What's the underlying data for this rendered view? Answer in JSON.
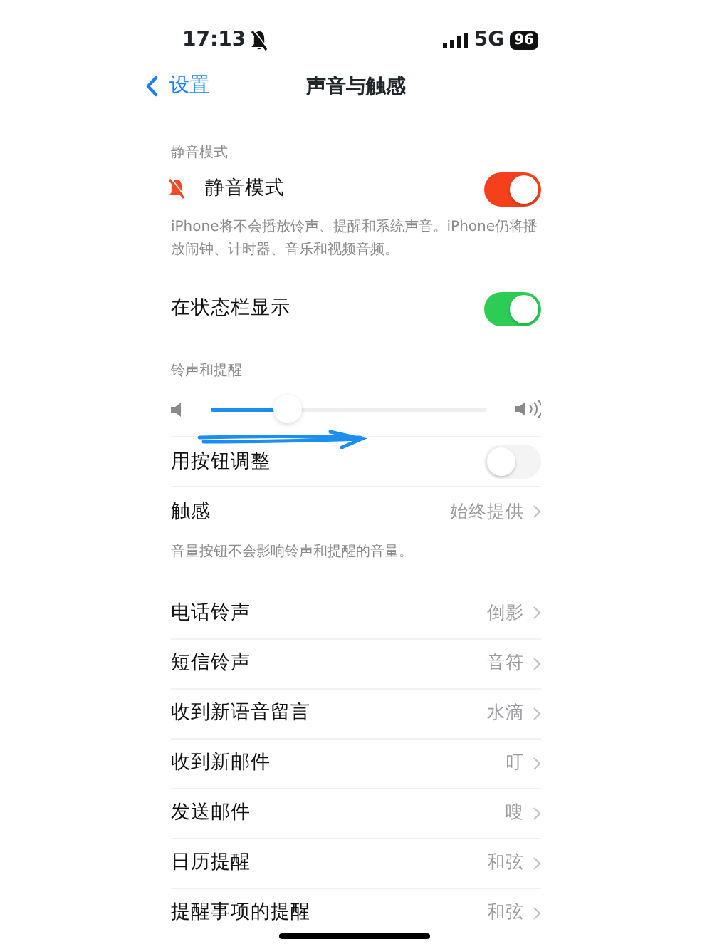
{
  "status_bar": {
    "time": "17:13",
    "silent": true,
    "network": "5G",
    "battery": "96"
  },
  "nav": {
    "back": "设置",
    "title": "声音与触感"
  },
  "silent_section": {
    "header": "静音模式",
    "row": {
      "label": "静音模式",
      "on": true
    },
    "footer": "iPhone将不会播放铃声、提醒和系统声音。iPhone仍将播放闹钟、计时器、音乐和视频音频。"
  },
  "status_row": {
    "label": "在状态栏显示",
    "on": true
  },
  "ring_section": {
    "header": "铃声和提醒",
    "volume": {
      "level": 0.28
    },
    "adjust_row": {
      "label": "用按钮调整",
      "on": false
    },
    "haptics": {
      "label": "触感",
      "value": "始终提供"
    },
    "footer": "音量按钮不会影响铃声和提醒的音量。"
  },
  "sounds": [
    {
      "label": "电话铃声",
      "value": "倒影"
    },
    {
      "label": "短信铃声",
      "value": "音符"
    },
    {
      "label": "收到新语音留言",
      "value": "水滴"
    },
    {
      "label": "收到新邮件",
      "value": "叮"
    },
    {
      "label": "发送邮件",
      "value": "嗖"
    },
    {
      "label": "日历提醒",
      "value": "和弦"
    },
    {
      "label": "提醒事项的提醒",
      "value": "和弦"
    }
  ]
}
